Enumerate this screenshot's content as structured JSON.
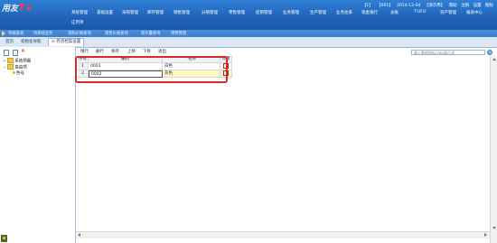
{
  "header": {
    "logo_text": "用友",
    "logo_mark": "T+",
    "menu_row1": [
      "系统管理",
      "基础设置",
      "采购管理",
      "库存管理",
      "销售管理",
      "分销管理",
      "零售管理",
      "促销管理",
      "业务管理",
      "生产管理",
      "业务往来",
      "现金银行",
      "总账",
      "T-UFO",
      "资产管理",
      "报表中心"
    ],
    "menu_row2": [
      "应用项"
    ],
    "user": {
      "account": "【1】",
      "code": "【001】",
      "date": "2014-12-04",
      "user": "【演示用】",
      "help": "帮助",
      "exit": "注销",
      "settings": "设置",
      "home": "图标"
    }
  },
  "quicklinks": [
    "单据查询",
    "待审核业务",
    "采购价格查询",
    "销售价格查询",
    "现存量查询",
    "预警管理"
  ],
  "tabs": [
    {
      "label": "首页",
      "active": false
    },
    {
      "label": "初始化导航",
      "active": false
    },
    {
      "label": "⊙ 存货档案设置",
      "active": true
    }
  ],
  "tree": [
    {
      "label": "系统预置",
      "level": 0,
      "type": "folder",
      "expander": "+"
    },
    {
      "label": "自由项",
      "level": 0,
      "type": "folder",
      "expander": "−"
    },
    {
      "label": "色号",
      "level": 1,
      "type": "leaf"
    }
  ],
  "toolbar": {
    "items": [
      "增行",
      "删行",
      "保存",
      "上移",
      "下移",
      "退出"
    ]
  },
  "search": {
    "placeholder": "输入数据指标/vba键过滤"
  },
  "grid": {
    "headers": [
      "序号",
      "编码",
      "*名称",
      "停用"
    ],
    "rows": [
      {
        "index": "1",
        "code": "0001",
        "name": "白色",
        "disabled": false
      },
      {
        "index": "2",
        "code": "0002",
        "name": "灰色",
        "disabled": false
      }
    ]
  },
  "colors": {
    "header_blue": "#1f63b8",
    "highlight_red": "#d62b2b",
    "selected_row": "#fff9c4"
  }
}
